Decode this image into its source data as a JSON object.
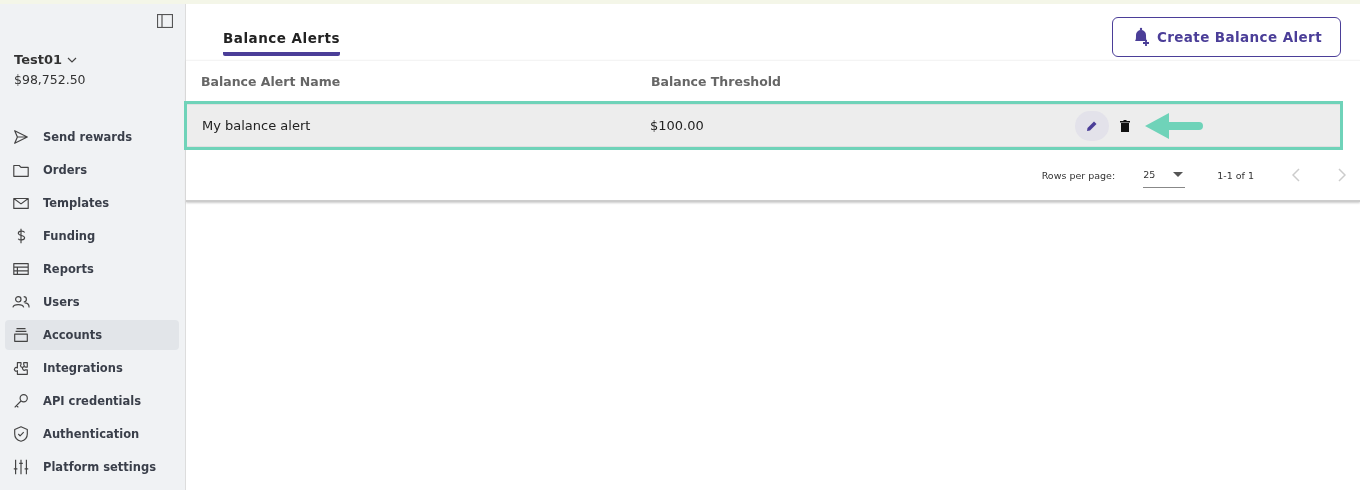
{
  "account": {
    "name": "Test01",
    "balance": "$98,752.50"
  },
  "nav": [
    {
      "label": "Send rewards",
      "selected": false
    },
    {
      "label": "Orders",
      "selected": false
    },
    {
      "label": "Templates",
      "selected": false
    },
    {
      "label": "Funding",
      "selected": false
    },
    {
      "label": "Reports",
      "selected": false
    },
    {
      "label": "Users",
      "selected": false
    },
    {
      "label": "Accounts",
      "selected": true
    },
    {
      "label": "Integrations",
      "selected": false
    },
    {
      "label": "API credentials",
      "selected": false
    },
    {
      "label": "Authentication",
      "selected": false
    },
    {
      "label": "Platform settings",
      "selected": false
    }
  ],
  "tabs": [
    {
      "label": "Balance Alerts",
      "selected": true
    }
  ],
  "create_button": "Create Balance Alert",
  "table": {
    "columns": [
      "Balance Alert Name",
      "Balance Threshold"
    ],
    "rows": [
      {
        "cells": [
          "My balance alert",
          "$100.00"
        ],
        "selected": true
      }
    ]
  },
  "pagination": {
    "rows_per_page_label": "Rows per page:",
    "rows_per_page": "25",
    "range": "1-1 of 1"
  }
}
